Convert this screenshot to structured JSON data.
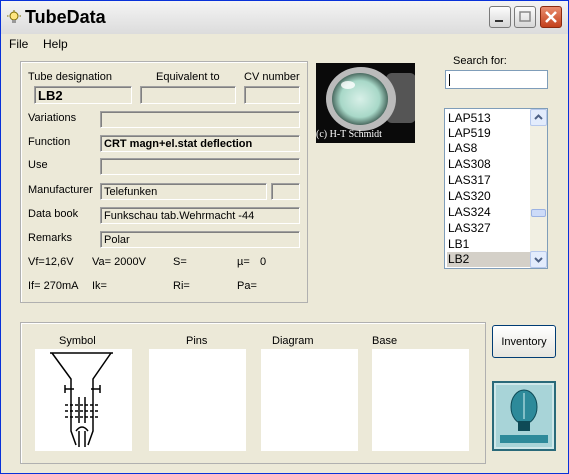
{
  "window": {
    "title": "TubeData"
  },
  "menu": {
    "file": "File",
    "help": "Help"
  },
  "form": {
    "tube_designation_label": "Tube designation",
    "equivalent_label": "Equivalent to",
    "cv_label": "CV number",
    "tube_designation": "LB2",
    "equivalent": "",
    "cv_number": "",
    "variations_label": "Variations",
    "variations": "",
    "function_label": "Function",
    "function": "CRT magn+el.stat deflection",
    "use_label": "Use",
    "use": "",
    "manufacturer_label": "Manufacturer",
    "manufacturer": "Telefunken",
    "manufacturer_extra": "",
    "databook_label": "Data book",
    "databook": "Funkschau tab.Wehrmacht -44",
    "remarks_label": "Remarks",
    "remarks": "Polar",
    "params": {
      "vf": "Vf=12,6V",
      "va": "Va= 2000V",
      "s": "S=",
      "mu": "µ=",
      "mu_val": "0",
      "if": "If= 270mA",
      "ik": "Ik=",
      "ri": "Ri=",
      "pa": "Pa="
    }
  },
  "photo": {
    "credit": "(c) H-T Schmidt"
  },
  "search": {
    "label": "Search for:",
    "value": ""
  },
  "list": {
    "items": [
      "LAP513",
      "LAP519",
      "LAS8",
      "LAS308",
      "LAS317",
      "LAS320",
      "LAS324",
      "LAS327",
      "LB1",
      "LB2"
    ],
    "selected": "LB2"
  },
  "bottom": {
    "symbol": "Symbol",
    "pins": "Pins",
    "diagram": "Diagram",
    "base": "Base"
  },
  "inventory_button": "Inventory",
  "colors": {
    "window_bg": "#ece9d8",
    "close_button": "#c3401b",
    "selection": "#d4d0c8"
  }
}
